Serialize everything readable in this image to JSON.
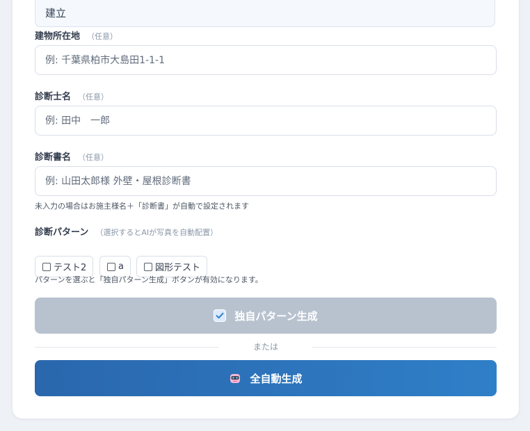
{
  "prev_field": {
    "value": "建立"
  },
  "fields": [
    {
      "label": "建物所在地",
      "optional": "（任意）",
      "placeholder": "例: 千葉県柏市大島田1-1-1"
    },
    {
      "label": "診断士名",
      "optional": "（任意）",
      "placeholder": "例: 田中　一郎"
    },
    {
      "label": "診断書名",
      "optional": "（任意）",
      "placeholder": "例: 山田太郎様 外壁・屋根診断書"
    }
  ],
  "report_name_hint": "未入力の場合はお施主様名＋「診断書」が自動で設定されます",
  "patterns": {
    "label": "診断パターン",
    "note": "（選択するとAIが写真を自動配置）",
    "options": [
      "テスト2",
      "a",
      "図形テスト"
    ],
    "hint": "パターンを選ぶと「独自パターン生成」ボタンが有効になります。"
  },
  "buttons": {
    "custom_generate": "独自パターン生成",
    "or": "または",
    "auto_generate": "全自動生成"
  },
  "colors": {
    "primary": "#2f7fc8",
    "disabled": "#b8c2cf"
  }
}
